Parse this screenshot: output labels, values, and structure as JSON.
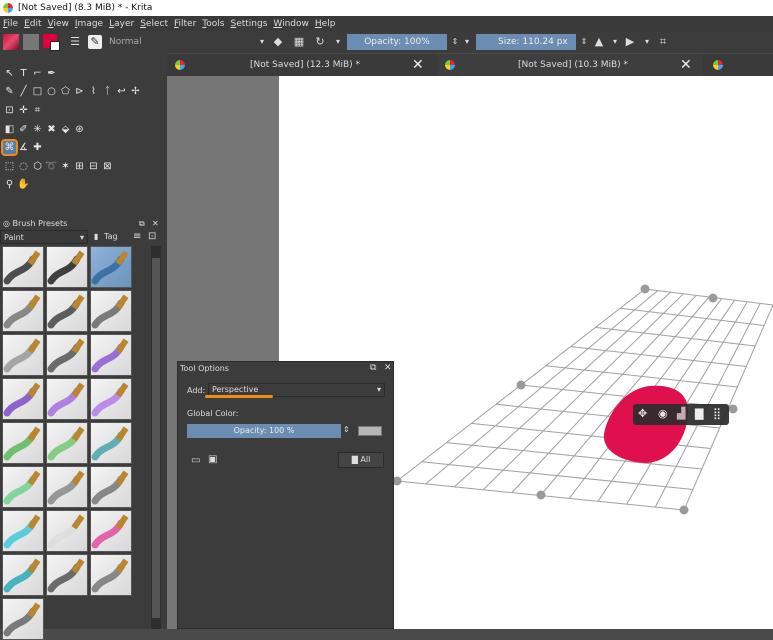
{
  "window": {
    "title": "[Not Saved]  (8.3 MiB) * - Krita"
  },
  "menu": [
    "File",
    "Edit",
    "View",
    "Image",
    "Layer",
    "Select",
    "Filter",
    "Tools",
    "Settings",
    "Window",
    "Help"
  ],
  "toolbar": {
    "blend_mode": "Normal",
    "opacity_label": "Opacity: 100%",
    "size_label": "Size: 110.24 px",
    "colors": {
      "foreground": "#e0003e",
      "background": "#777777",
      "accent": "#6b8db2"
    }
  },
  "tabs": [
    {
      "label": "[Not Saved]  (12.3 MiB) *"
    },
    {
      "label": "[Not Saved]  (10.3 MiB) *"
    }
  ],
  "brush_presets": {
    "title": "Brush Presets",
    "filter": "Paint",
    "tag_label": "Tag"
  },
  "tool_options": {
    "title": "Tool Options",
    "add_label": "Add:",
    "add_value": "Perspective",
    "global_color_label": "Global Color:",
    "opacity_label": "Opacity: 100 %",
    "all_button": "All"
  },
  "canvas": {
    "paint_color": "#e0104e",
    "grid_color": "#a0a0a0",
    "handle_color": "#9a9a9a"
  },
  "highlight": {
    "color": "#f08a1c"
  }
}
